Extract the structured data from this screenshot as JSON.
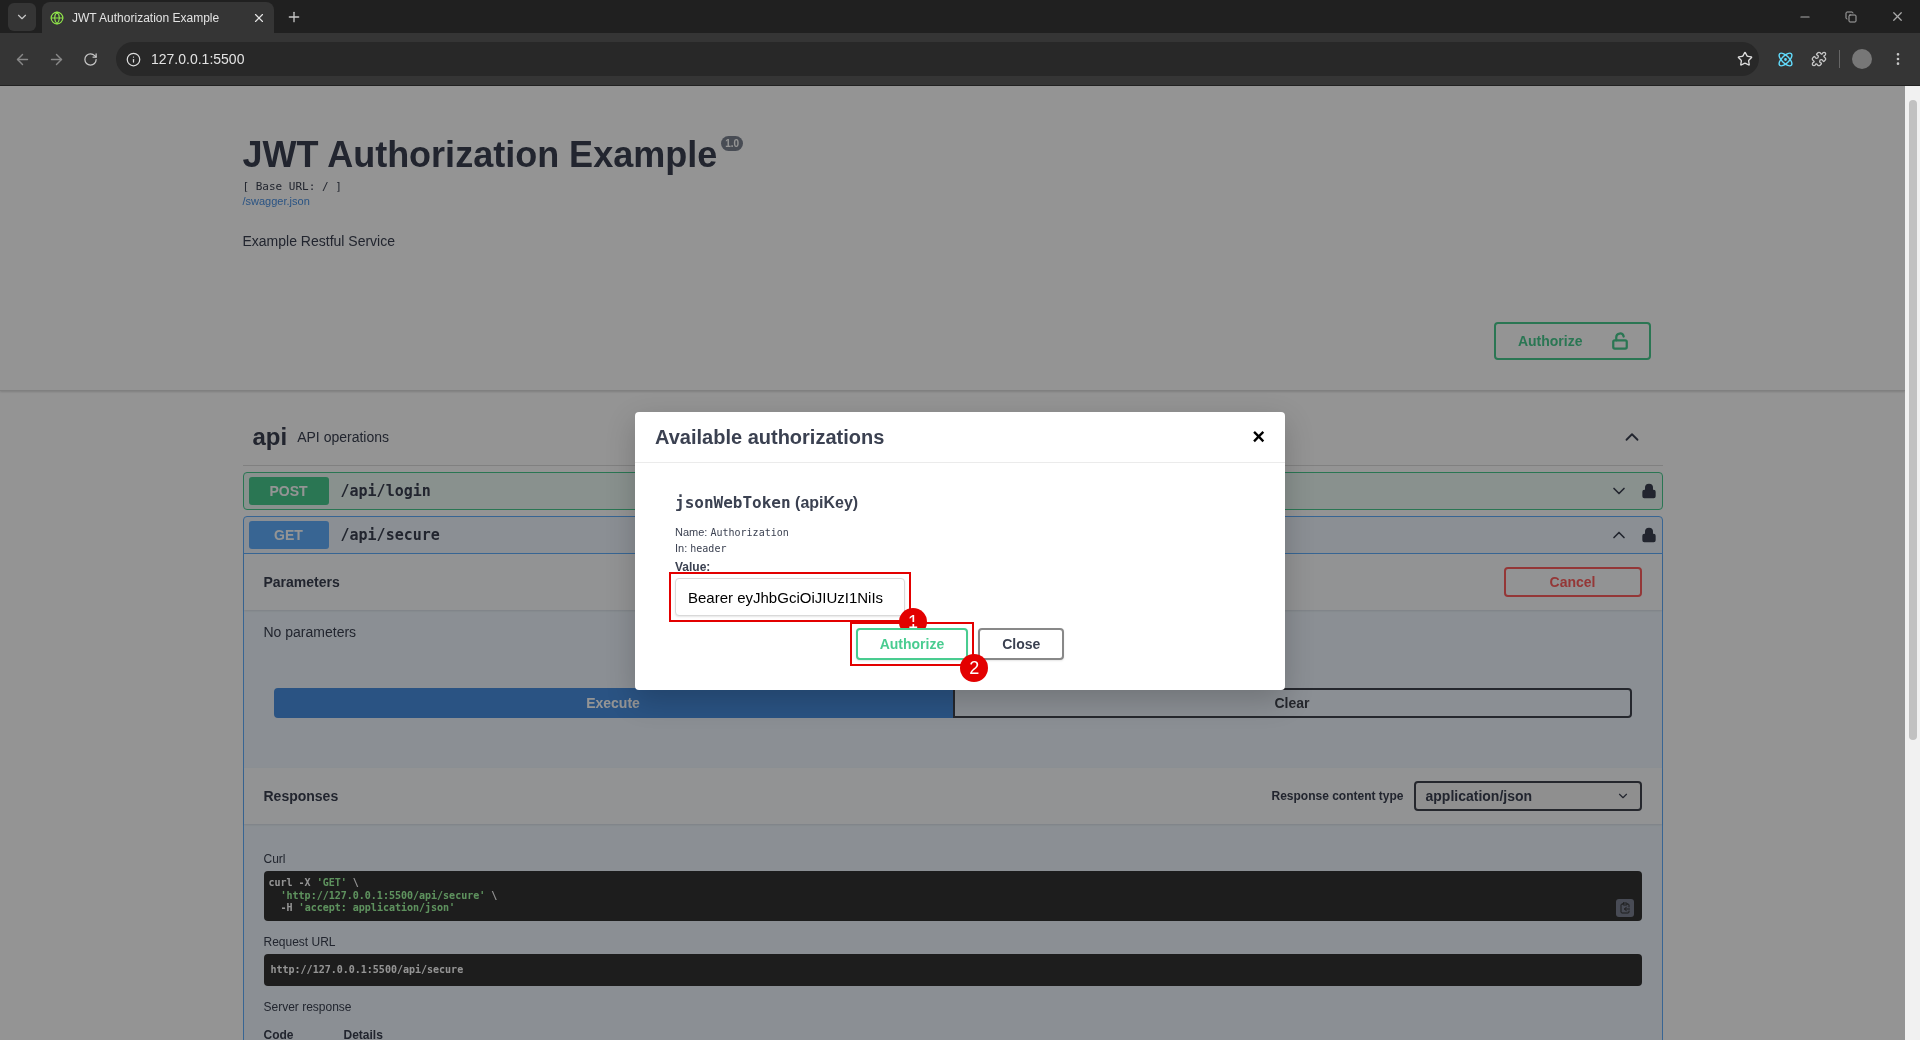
{
  "browser": {
    "tabs": [
      {
        "title": "JWT Authorization Example",
        "selected": true
      }
    ],
    "url": "127.0.0.1:5500"
  },
  "info": {
    "title": "JWT Authorization Example",
    "version": "1.0",
    "base_url": "[ Base URL: / ]",
    "spec_link": "/swagger.json",
    "description": "Example Restful Service",
    "authorize_button": "Authorize"
  },
  "tag": {
    "name": "api",
    "description": "API operations",
    "expanded": true
  },
  "operations": [
    {
      "method": "POST",
      "path": "/api/login",
      "expanded": false
    },
    {
      "method": "GET",
      "path": "/api/secure",
      "expanded": true
    }
  ],
  "details": {
    "parameters_title": "Parameters",
    "cancel": "Cancel",
    "no_params": "No parameters",
    "execute": "Execute",
    "clear": "Clear",
    "responses_title": "Responses",
    "content_type_label": "Response content type",
    "content_type_value": "application/json",
    "curl_label": "Curl",
    "curl_lines": [
      [
        {
          "text": "curl -X ",
          "kind": "plain"
        },
        {
          "text": "'GET'",
          "kind": "string"
        },
        {
          "text": " \\",
          "kind": "plain"
        }
      ],
      [
        {
          "text": "  'http://127.0.0.1:5500/api/secure'",
          "kind": "string"
        },
        {
          "text": " \\",
          "kind": "plain"
        }
      ],
      [
        {
          "text": "  -H ",
          "kind": "plain"
        },
        {
          "text": "'accept: application/json'",
          "kind": "string"
        }
      ]
    ],
    "request_url_label": "Request URL",
    "request_url": "http://127.0.0.1:5500/api/secure",
    "server_response_label": "Server response",
    "columns": [
      "Code",
      "Details"
    ]
  },
  "modal": {
    "title": "Available authorizations",
    "close": "×",
    "scheme_name": "jsonWebToken",
    "scheme_type": "(apiKey)",
    "name_label": "Name:",
    "name_value": "Authorization",
    "in_label": "In:",
    "in_value": "header",
    "value_label": "Value:",
    "value": "Bearer eyJhbGciOiJIUzI1NiIs",
    "buttons": [
      {
        "label": "Authorize",
        "kind": "primary"
      },
      {
        "label": "Close",
        "kind": "secondary"
      }
    ]
  },
  "annotations": [
    {
      "label": "1"
    },
    {
      "label": "2"
    }
  ]
}
